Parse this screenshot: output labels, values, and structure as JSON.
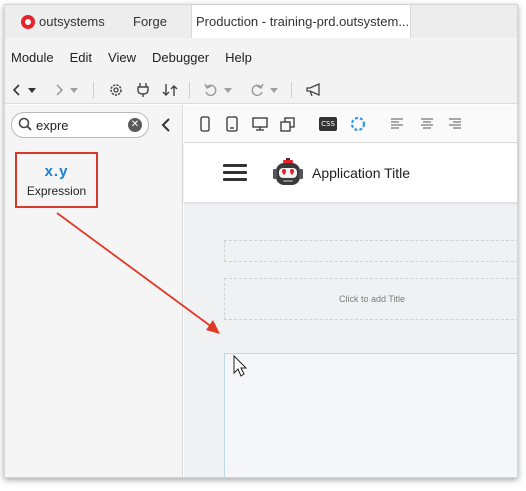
{
  "tabs": [
    {
      "label": "outsystems",
      "active": false
    },
    {
      "label": "Forge",
      "active": false
    },
    {
      "label": "Production - training-prd.outsystem...",
      "active": true
    }
  ],
  "menu": [
    "Module",
    "Edit",
    "View",
    "Debugger",
    "Help"
  ],
  "toolbar": {
    "back_icon": "chevron-left-icon",
    "forward_icon": "chevron-right-icon",
    "settings_icon": "gear-icon",
    "plug_icon": "plug-icon",
    "merge_icon": "merge-icon",
    "undo_icon": "undo-icon",
    "redo_icon": "redo-icon",
    "announce_icon": "megaphone-icon"
  },
  "search": {
    "value": "expre",
    "placeholder": ""
  },
  "widget": {
    "glyph": "x.y",
    "label": "Expression"
  },
  "canvas_toolbar": {
    "css_label": "CSS"
  },
  "app": {
    "title": "Application Title",
    "title_hint": "Click to add Title"
  },
  "colors": {
    "brand_red": "#e8222b",
    "highlight": "#d73a2a",
    "expression_blue": "#1a7fd1",
    "drop_zone": "#bcd8ee"
  }
}
